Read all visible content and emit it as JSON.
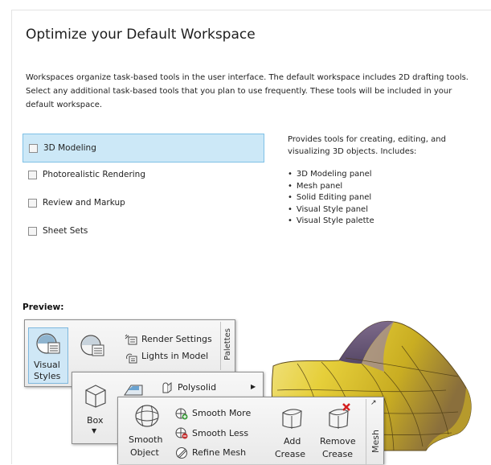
{
  "title": "Optimize your Default Workspace",
  "intro": "Workspaces organize task-based tools in the user interface. The default workspace includes 2D drafting tools. Select any additional task-based tools that you plan to use frequently. These tools will be included in your default workspace.",
  "options": [
    {
      "label": "3D Modeling",
      "checked": false,
      "selected": true
    },
    {
      "label": "Photorealistic Rendering",
      "checked": false,
      "selected": false
    },
    {
      "label": "Review and Markup",
      "checked": false,
      "selected": false
    },
    {
      "label": "Sheet Sets",
      "checked": false,
      "selected": false
    }
  ],
  "description": {
    "text": "Provides tools for creating, editing, and visualizing 3D objects. Includes:",
    "items": [
      "3D Modeling panel",
      "Mesh panel",
      "Solid Editing panel",
      "Visual Style panel",
      "Visual Style palette"
    ]
  },
  "preview": {
    "label": "Preview:",
    "palettes_panel": {
      "visual_styles_line1": "Visual",
      "visual_styles_line2": "Styles",
      "render_settings": "Render Settings",
      "lights_in_model": "Lights in Model",
      "tab": "Palettes"
    },
    "modeling_panel": {
      "polysolid": "Polysolid",
      "box": "Box"
    },
    "mesh_panel": {
      "smooth_object_line1": "Smooth",
      "smooth_object_line2": "Object",
      "smooth_more": "Smooth More",
      "smooth_less": "Smooth Less",
      "refine_mesh": "Refine Mesh",
      "add_crease_line1": "Add",
      "add_crease_line2": "Crease",
      "remove_crease_line1": "Remove",
      "remove_crease_line2": "Crease",
      "tab": "Mesh"
    }
  },
  "colors": {
    "selection_fill": "#cce8f7",
    "selection_border": "#7fc1e6",
    "mesh_yellow": "#e6cf3a",
    "mesh_purple": "#5b4a8a"
  }
}
